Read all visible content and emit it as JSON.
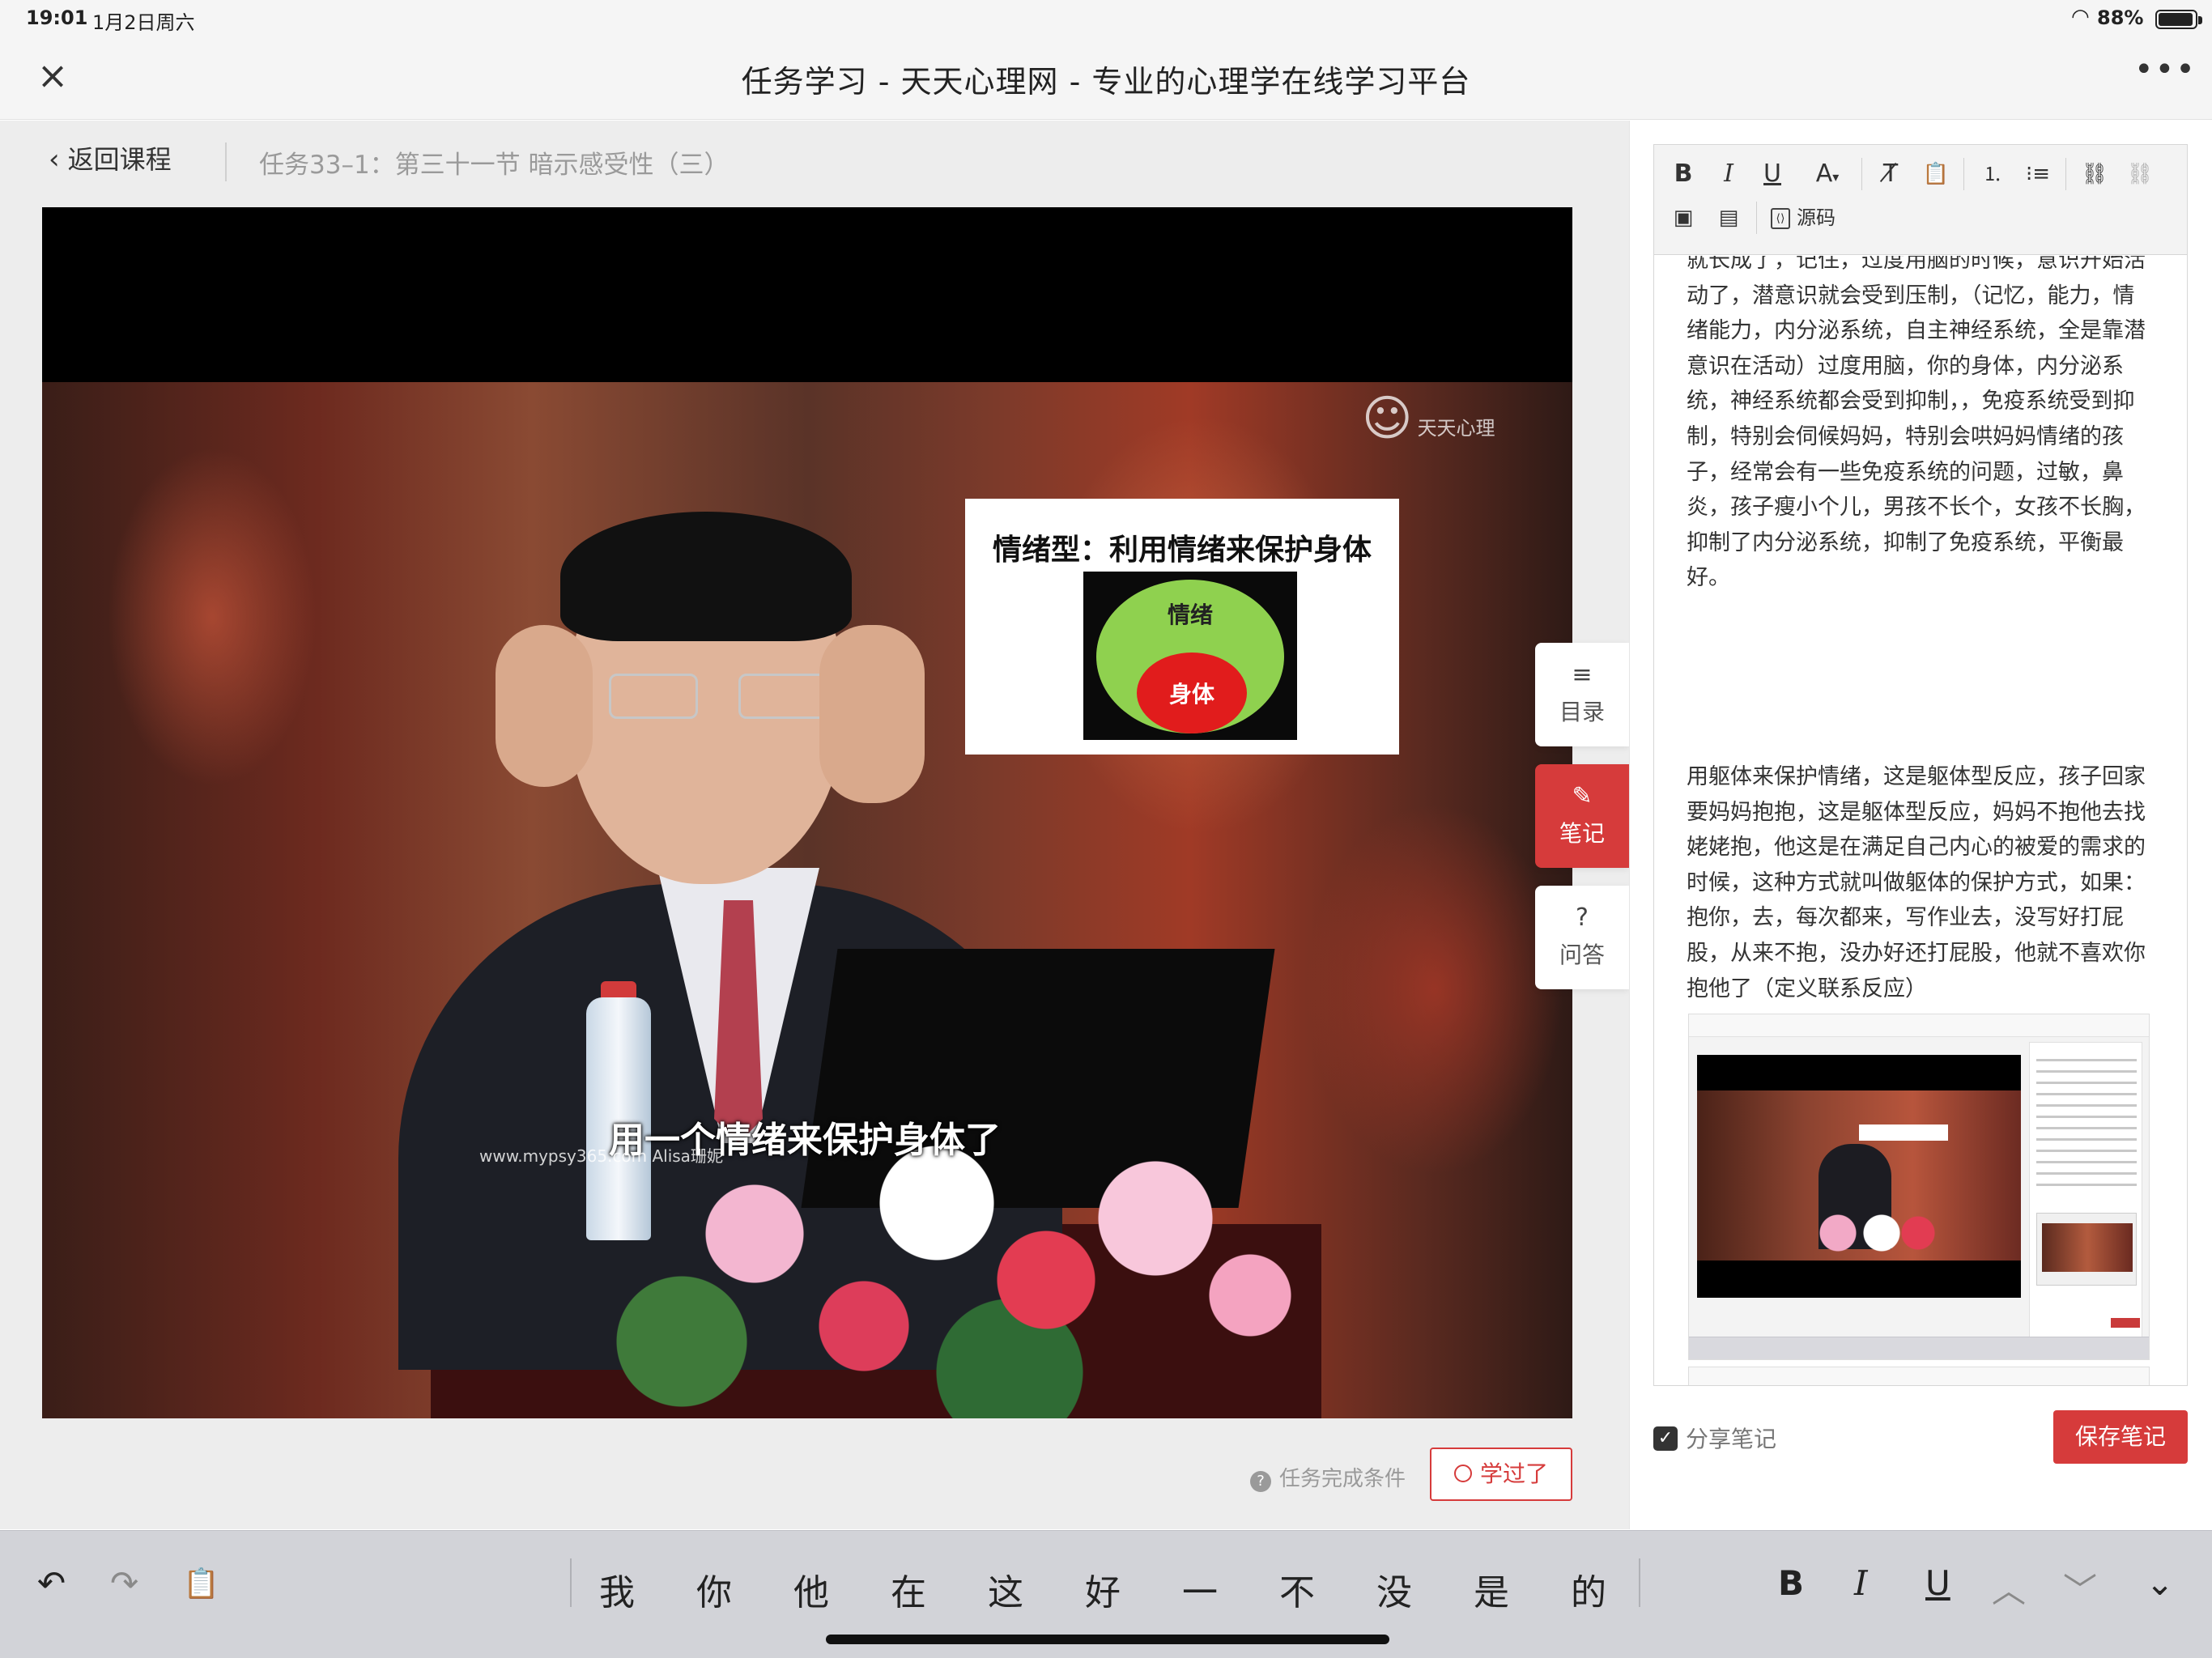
{
  "status_bar": {
    "time": "19:01",
    "date": "1月2日周六",
    "battery": "88%"
  },
  "window": {
    "title": "任务学习 - 天天心理网 - 专业的心理学在线学习平台",
    "close_icon": "×",
    "more_icon": "•••"
  },
  "breadcrumb": {
    "back_label": "返回课程",
    "task_title": "任务33–1：第三十一节 暗示感受性（三）"
  },
  "video": {
    "slide_title": "情绪型：利用情绪来保护身体",
    "outer_label": "情绪",
    "inner_label": "身体",
    "watermark": "天天心理",
    "subtitle": "用一个情绪来保护身体了",
    "site_mark": "www.mypsy365.com Alisa珊妮"
  },
  "side_tabs": {
    "toc": "目录",
    "note": "笔记",
    "qa": "问答"
  },
  "task_footer": {
    "condition_label": "任务完成条件",
    "learned_label": "学过了"
  },
  "editor": {
    "toolbar": {
      "bold": "B",
      "italic": "I",
      "underline": "U",
      "font_color": "A",
      "source_label": "源码"
    },
    "note_paragraphs": [
      "就长成了，记住，过度用脑的时候，意识开始活动了，潜意识就会受到压制，（记忆，能力，情绪能力，内分泌系统，自主神经系统，全是靠潜意识在活动）过度用脑，你的身体，内分泌系统，神经系统都会受到抑制，，免疫系统受到抑制，特别会伺候妈妈，特别会哄妈妈情绪的孩子，经常会有一些免疫系统的问题，过敏，鼻炎，孩子瘦小个儿，男孩不长个，女孩不长胸，抑制了内分泌系统，抑制了免疫系统，平衡最好。",
      "用躯体来保护情绪，这是躯体型反应，孩子回家要妈妈抱抱，这是躯体型反应，妈妈不抱他去找姥姥抱，他这是在满足自己内心的被爱的需求的时候，这种方式就叫做躯体的保护方式，如果：抱你，去，每次都来，写作业去，没写好打屁股，从来不抱，没办好还打屁股，他就不喜欢你抱他了（定义联系反应）"
    ]
  },
  "share": {
    "label": "分享笔记",
    "checked": true
  },
  "save_button": {
    "label": "保存笔记"
  },
  "keyboard": {
    "candidates": [
      "我",
      "你",
      "他",
      "在",
      "这",
      "好",
      "一",
      "不",
      "没",
      "是",
      "的"
    ],
    "format": {
      "bold": "B",
      "italic": "I",
      "underline": "U"
    }
  },
  "colors": {
    "accent_red": "#d63b3b",
    "page_bg": "#ededed"
  }
}
